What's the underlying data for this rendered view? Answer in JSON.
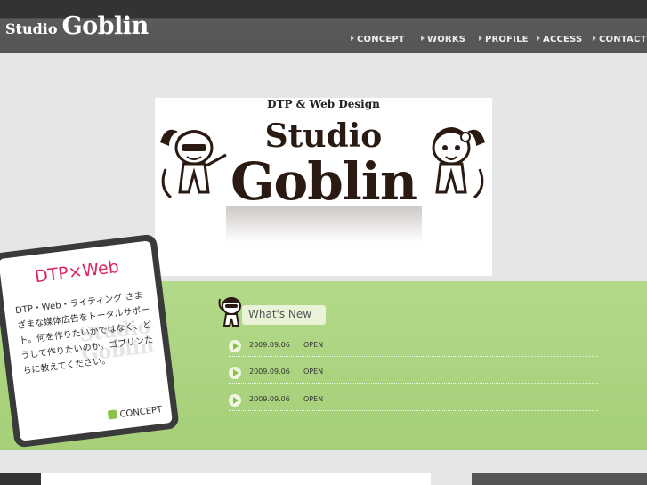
{
  "header": {
    "logo_small": "Studio",
    "logo_big": "Goblin",
    "nav": [
      {
        "label": "CONCEPT"
      },
      {
        "label": "WORKS"
      },
      {
        "label": "PROFILE"
      },
      {
        "label": "ACCESS"
      },
      {
        "label": "CONTACT"
      }
    ]
  },
  "banner": {
    "subtitle": "DTP & Web Design",
    "title_line1": "Studio",
    "title_line2": "Goblin"
  },
  "card": {
    "heading": "DTP×Web",
    "text": "DTP・Web・ライティング さまざまな媒体広告をトータルサポート。何を作りたいかではなく、どうして作りたいのか。ゴブリンたちに教えてください。",
    "watermark": "Studio Goblin",
    "link_label": "CONCEPT"
  },
  "news": {
    "heading": "What's New",
    "items": [
      {
        "date": "2009.09.06",
        "text": "OPEN"
      },
      {
        "date": "2009.09.06",
        "text": "OPEN"
      },
      {
        "date": "2009.09.06",
        "text": "OPEN"
      }
    ]
  },
  "colors": {
    "accent_pink": "#e0245e",
    "green_band": "#a9d37a",
    "header_dark": "#3e3e3e"
  }
}
